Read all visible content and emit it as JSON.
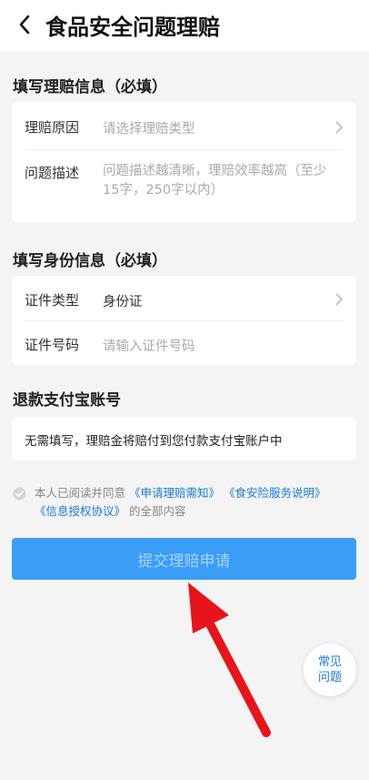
{
  "header": {
    "title": "食品安全问题理赔"
  },
  "claim_section": {
    "title": "填写理赔信息（必填）",
    "reason_label": "理赔原因",
    "reason_placeholder": "请选择理赔类型",
    "desc_label": "问题描述",
    "desc_placeholder_line1": "问题描述越清晰，理赔效率越高（至少",
    "desc_placeholder_line2": "15字，250字以内）"
  },
  "identity_section": {
    "title": "填写身份信息（必填）",
    "id_type_label": "证件类型",
    "id_type_value": "身份证",
    "id_number_label": "证件号码",
    "id_number_placeholder": "请输入证件号码"
  },
  "refund_section": {
    "title": "退款支付宝账号",
    "notice": "无需填写，理赔金将赔付到您付款支付宝账户中"
  },
  "agreement": {
    "prefix": "本人已阅读并同意",
    "link1": "《申请理赔需知》",
    "link2": "《食安险服务说明》",
    "link3": "《信息授权协议》",
    "suffix": "的全部内容"
  },
  "submit": {
    "label": "提交理赔申请"
  },
  "faq": {
    "line1": "常见",
    "line2": "问题"
  },
  "colors": {
    "primary_button": "#3a9df6",
    "link": "#1a7bd6",
    "annotation_arrow": "#e8141b"
  },
  "icons": {
    "back": "back-arrow-icon",
    "chevron": "chevron-right-icon",
    "check": "check-circle-icon"
  }
}
